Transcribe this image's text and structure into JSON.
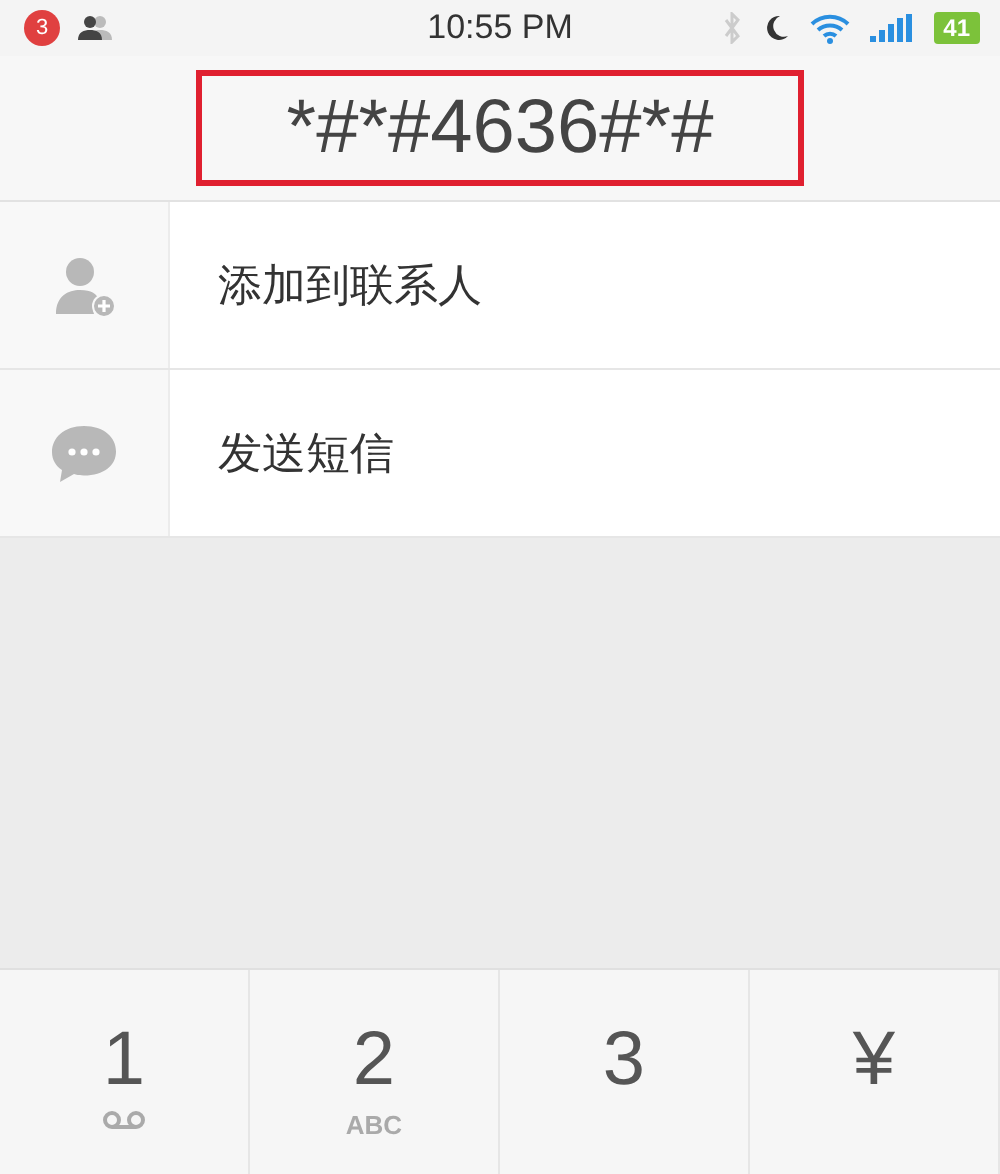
{
  "status_bar": {
    "badge": "3",
    "time": "10:55 PM",
    "battery": "41"
  },
  "dialed_number": "*#*#4636#*#",
  "actions": [
    {
      "kind": "contact",
      "label": "添加到联系人"
    },
    {
      "kind": "sms",
      "label": "发送短信"
    }
  ],
  "keypad": [
    {
      "digit": "1",
      "kind": "voicemail"
    },
    {
      "digit": "2",
      "letters": "ABC"
    },
    {
      "digit": "3"
    },
    {
      "digit": "¥"
    }
  ]
}
